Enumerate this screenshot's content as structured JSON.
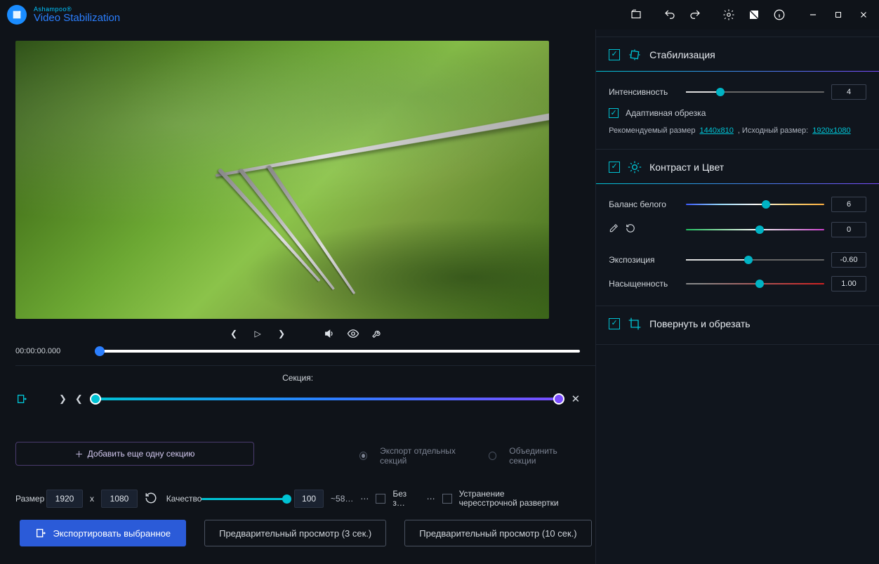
{
  "title": {
    "brand": "Ashampoo®",
    "product": "Video Stabilization"
  },
  "player": {
    "timecode": "00:00:00.000"
  },
  "section": {
    "label": "Секция:"
  },
  "add_section": "Добавить еще одну секцию",
  "export_opts": {
    "separate": "Экспорт отдельных секций",
    "merge": "Объединить секции"
  },
  "export_row": {
    "size_label": "Размер",
    "width": "1920",
    "height": "1080",
    "quality_label": "Качество",
    "quality_value": "100",
    "approx": "~58…",
    "no_sound": "Без з…",
    "deinterlace": "Устранение чересстрочной развертки"
  },
  "bottom": {
    "export": "Экспортировать выбранное",
    "preview3": "Предварительный просмотр (3 сек.)",
    "preview10": "Предварительный просмотр (10 сек.)"
  },
  "stab": {
    "title": "Стабилизация",
    "intensity": "Интенсивность",
    "intensity_val": "4",
    "adaptive": "Адаптивная обрезка",
    "rec_label": "Рекомендуемый размер",
    "rec_val": "1440x810",
    "orig_label": ", Исходный размер:",
    "orig_val": "1920x1080"
  },
  "color": {
    "title": "Контраст и Цвет",
    "wb": "Баланс белого",
    "wb_val": "6",
    "tint_val": "0",
    "expo": "Экспозиция",
    "expo_val": "-0.60",
    "sat": "Насыщенность",
    "sat_val": "1.00"
  },
  "rotate": {
    "title": "Повернуть и обрезать"
  }
}
